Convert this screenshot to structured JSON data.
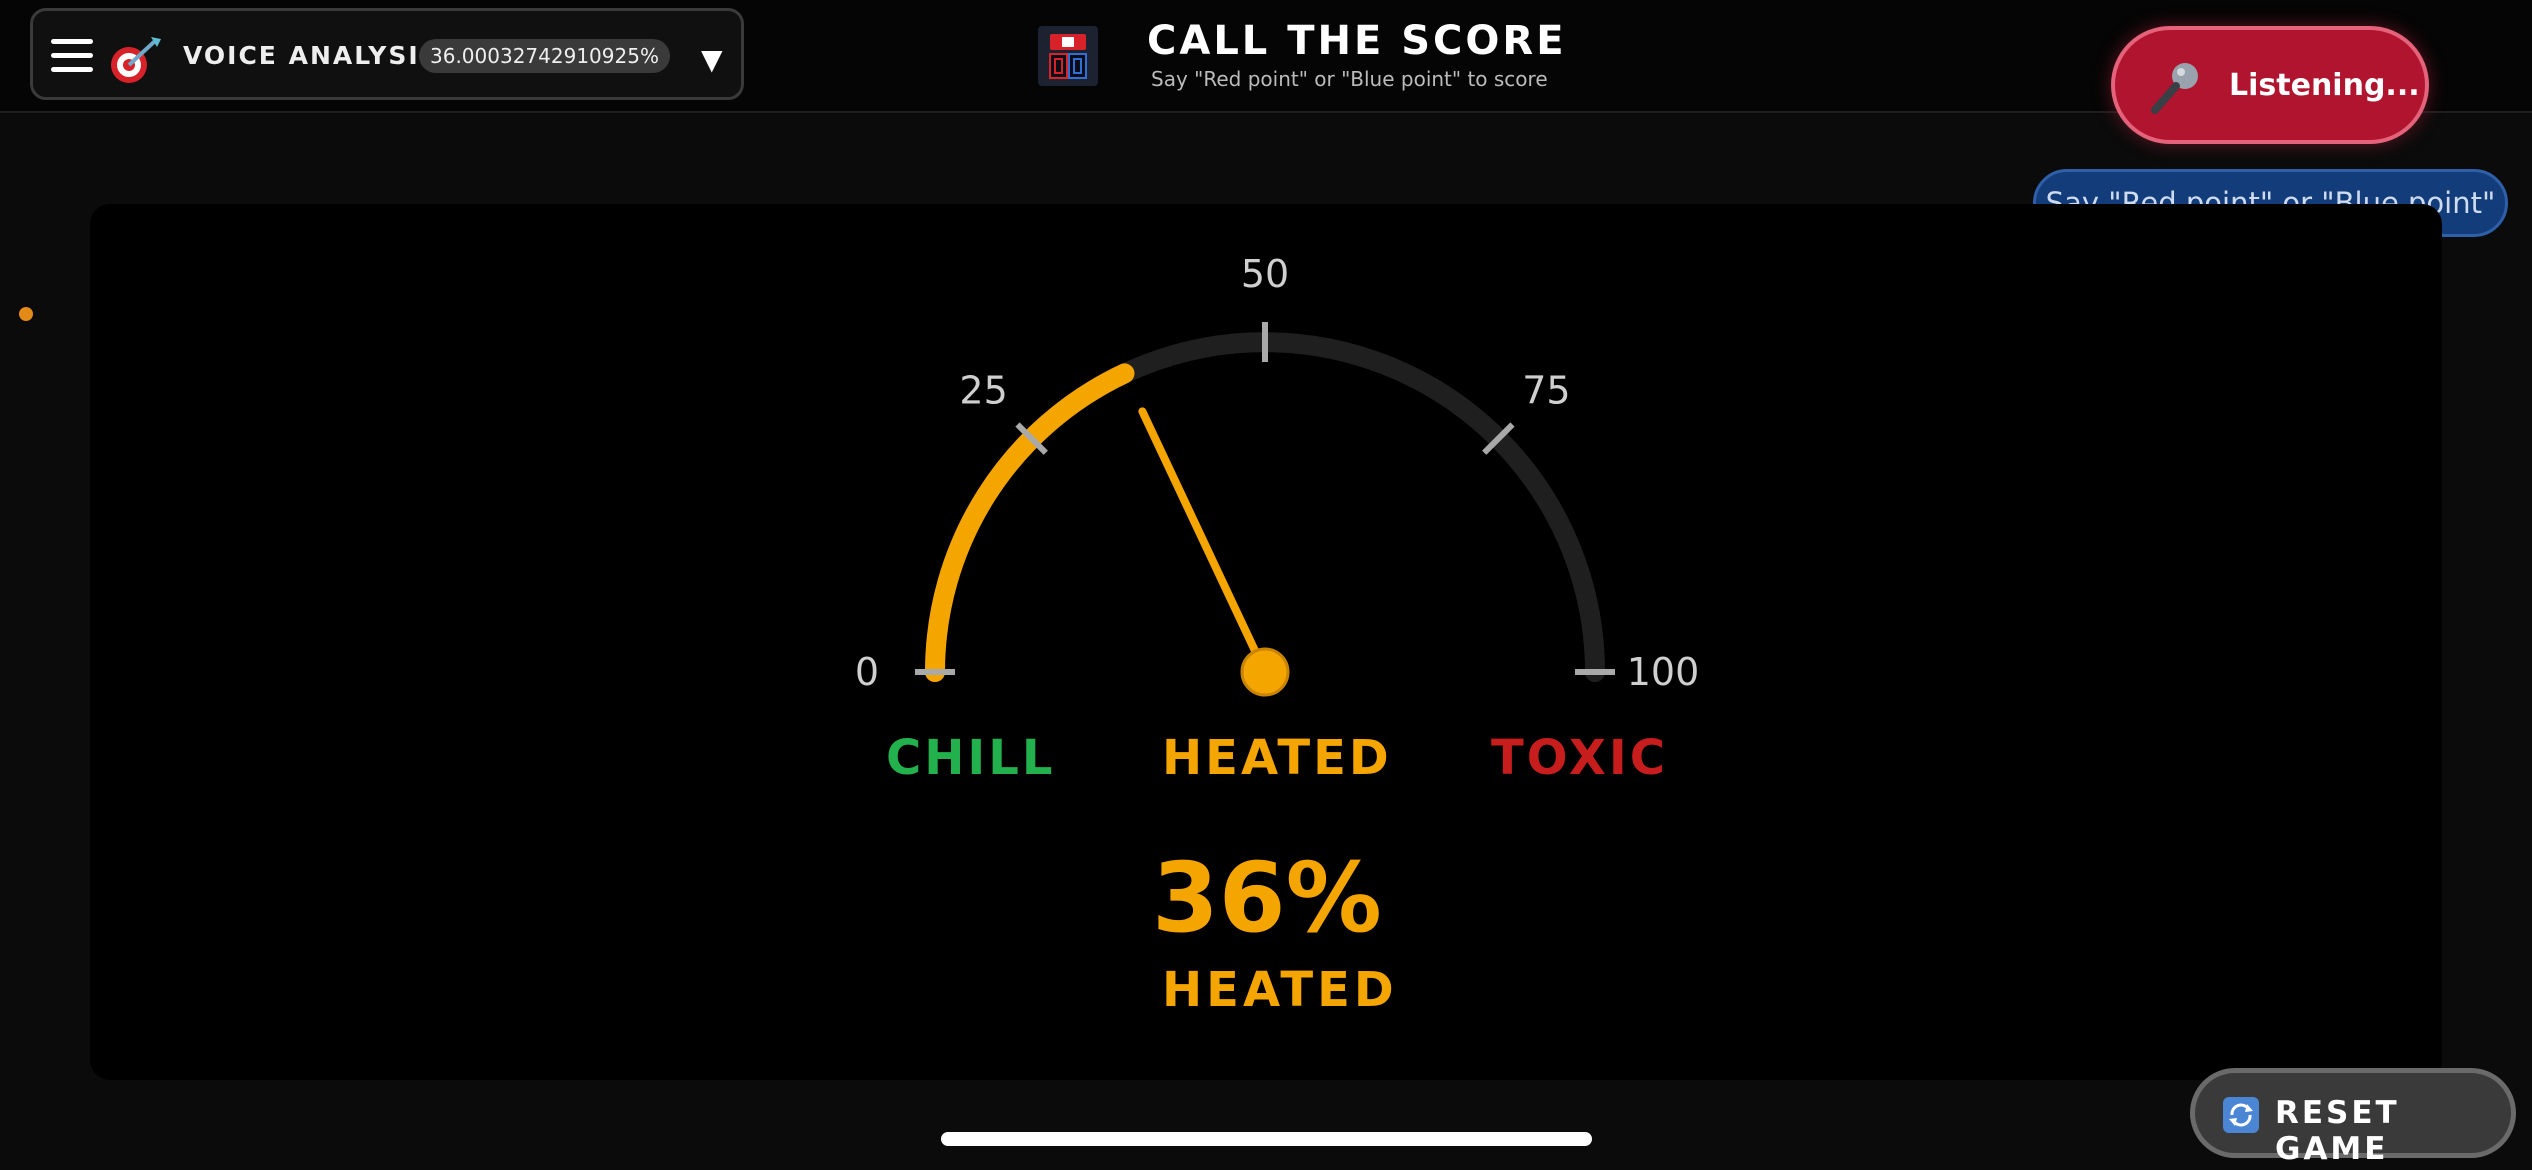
{
  "header": {
    "menu_icon": "hamburger-icon",
    "analysis_icon": "dart-target-icon",
    "voice_analysis_label": "VOICE ANALYSIS",
    "voice_analysis_value": "36.00032742910925%",
    "dropdown_icon": "triangle-down-icon",
    "scoreboard_icon": "scoreboard-icon",
    "title": "CALL THE SCORE",
    "subtitle": "Say \"Red point\" or \"Blue point\" to score"
  },
  "listening_button": {
    "icon": "microphone-icon",
    "label": "Listening..."
  },
  "hint": "Say \"Red point\" or \"Blue point\"",
  "gauge": {
    "value": 36.00032742910925,
    "min": 0,
    "max": 100,
    "tick_labels": [
      "0",
      "25",
      "50",
      "75",
      "100"
    ],
    "zone_labels": {
      "chill": "CHILL",
      "heated": "HEATED",
      "toxic": "TOXIC"
    },
    "percent_display": "36%",
    "status": "HEATED",
    "colors": {
      "fill": "#f5a500",
      "track": "#1f1f1f",
      "chill": "#22b14c",
      "heated": "#f5a500",
      "toxic": "#c81d1d"
    }
  },
  "reset_button": {
    "icon": "refresh-icon",
    "label": "RESET GAME"
  }
}
